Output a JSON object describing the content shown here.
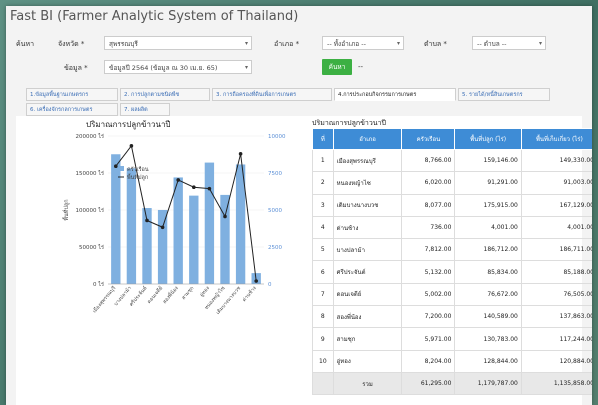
{
  "app": {
    "title": "Fast BI (Farmer Analytic System of Thailand)"
  },
  "filters": {
    "search_label": "ค้นหา",
    "province_label": "จังหวัด *",
    "province_value": "สุพรรณบุรี",
    "district_label": "อำเภอ *",
    "district_value": "-- ทั้งอำเภอ --",
    "subdistrict_label": "ตำบล *",
    "subdistrict_value": "-- ตำบล --",
    "data_label": "ข้อมูล *",
    "data_value": "ข้อมูลปี 2564 (ข้อมูล ณ 30 เม.ย. 65)",
    "search_button": "ค้นหา",
    "extra": "--"
  },
  "tabs": [
    {
      "label": "1.ข้อมูลพื้นฐานเกษตรกร",
      "active": false
    },
    {
      "label": "2. การปลูกตามชนิดพืช",
      "active": false
    },
    {
      "label": "3. การถือครองที่ดินเพื่อการเกษตร",
      "active": false
    },
    {
      "label": "4.การประกอบกิจกรรมการเกษตร",
      "active": true
    },
    {
      "label": "5. รายได้/หนี้สินเกษตรกร",
      "active": false
    },
    {
      "label": "6. เครื่องจักรกลการเกษตร",
      "active": false
    },
    {
      "label": "7. ผลผลิต",
      "active": false
    }
  ],
  "chart_data": {
    "type": "bar",
    "title": "ปริมาณการปลูกข้าวนาปี",
    "categories": [
      "เมืองสุพรรณบุรี",
      "บางปลาม้า",
      "ศรีประจันต์",
      "ดอนเจดีย์",
      "สองพี่น้อง",
      "สามชุก",
      "อู่ทอง",
      "หนองหญ้าไซ",
      "เดิมบางนางบวช",
      "ด่านช้าง"
    ],
    "series": [
      {
        "name": "ครัวเรือน",
        "axis": "right",
        "values": [
          8766,
          7812,
          5132,
          5002,
          7200,
          5971,
          8204,
          6020,
          8077,
          736
        ],
        "color": "#7fb0e0"
      },
      {
        "name": "พื้นที่ปลูก",
        "axis": "left",
        "values": [
          159146,
          186712,
          85834,
          76672,
          140589,
          130783,
          128844,
          91291,
          175915,
          4001
        ],
        "color": "#222222"
      }
    ],
    "ylabel": "พื้นที่ปลูก",
    "ylim": [
      0,
      200000
    ],
    "y2lim": [
      0,
      10000
    ],
    "yticks": [
      "200000 ไร่",
      "150000 ไร่",
      "100000 ไร่",
      "50000 ไร่",
      "0 ไร่"
    ],
    "y2ticks": [
      "10000",
      "7500",
      "5000",
      "2500",
      "0"
    ],
    "legend": "top-left"
  },
  "table": {
    "title": "ปริมาณการปลูกข้าวนาปี",
    "headers": [
      "ที่",
      "อำเภอ",
      "ครัวเรือน",
      "พื้นที่ปลูก (ไร่)",
      "พื้นที่เก็บเกี่ยว (ไร่)"
    ],
    "rows": [
      [
        "1",
        "เมืองสุพรรณบุรี",
        "8,766.00",
        "159,146.00",
        "149,330.00"
      ],
      [
        "2",
        "หนองหญ้าไซ",
        "6,020.00",
        "91,291.00",
        "91,003.00"
      ],
      [
        "3",
        "เดิมบางนางบวช",
        "8,077.00",
        "175,915.00",
        "167,129.00"
      ],
      [
        "4",
        "ด่านช้าง",
        "736.00",
        "4,001.00",
        "4,001.00"
      ],
      [
        "5",
        "บางปลาม้า",
        "7,812.00",
        "186,712.00",
        "186,711.00"
      ],
      [
        "6",
        "ศรีประจันต์",
        "5,132.00",
        "85,834.00",
        "85,188.00"
      ],
      [
        "7",
        "ดอนเจดีย์",
        "5,002.00",
        "76,672.00",
        "76,505.00"
      ],
      [
        "8",
        "สองพี่น้อง",
        "7,200.00",
        "140,589.00",
        "137,863.00"
      ],
      [
        "9",
        "สามชุก",
        "5,971.00",
        "130,783.00",
        "117,244.00"
      ],
      [
        "10",
        "อู่ทอง",
        "8,204.00",
        "128,844.00",
        "120,884.00"
      ]
    ],
    "total": [
      "",
      "รวม",
      "61,295.00",
      "1,179,787.00",
      "1,135,858.00"
    ]
  }
}
